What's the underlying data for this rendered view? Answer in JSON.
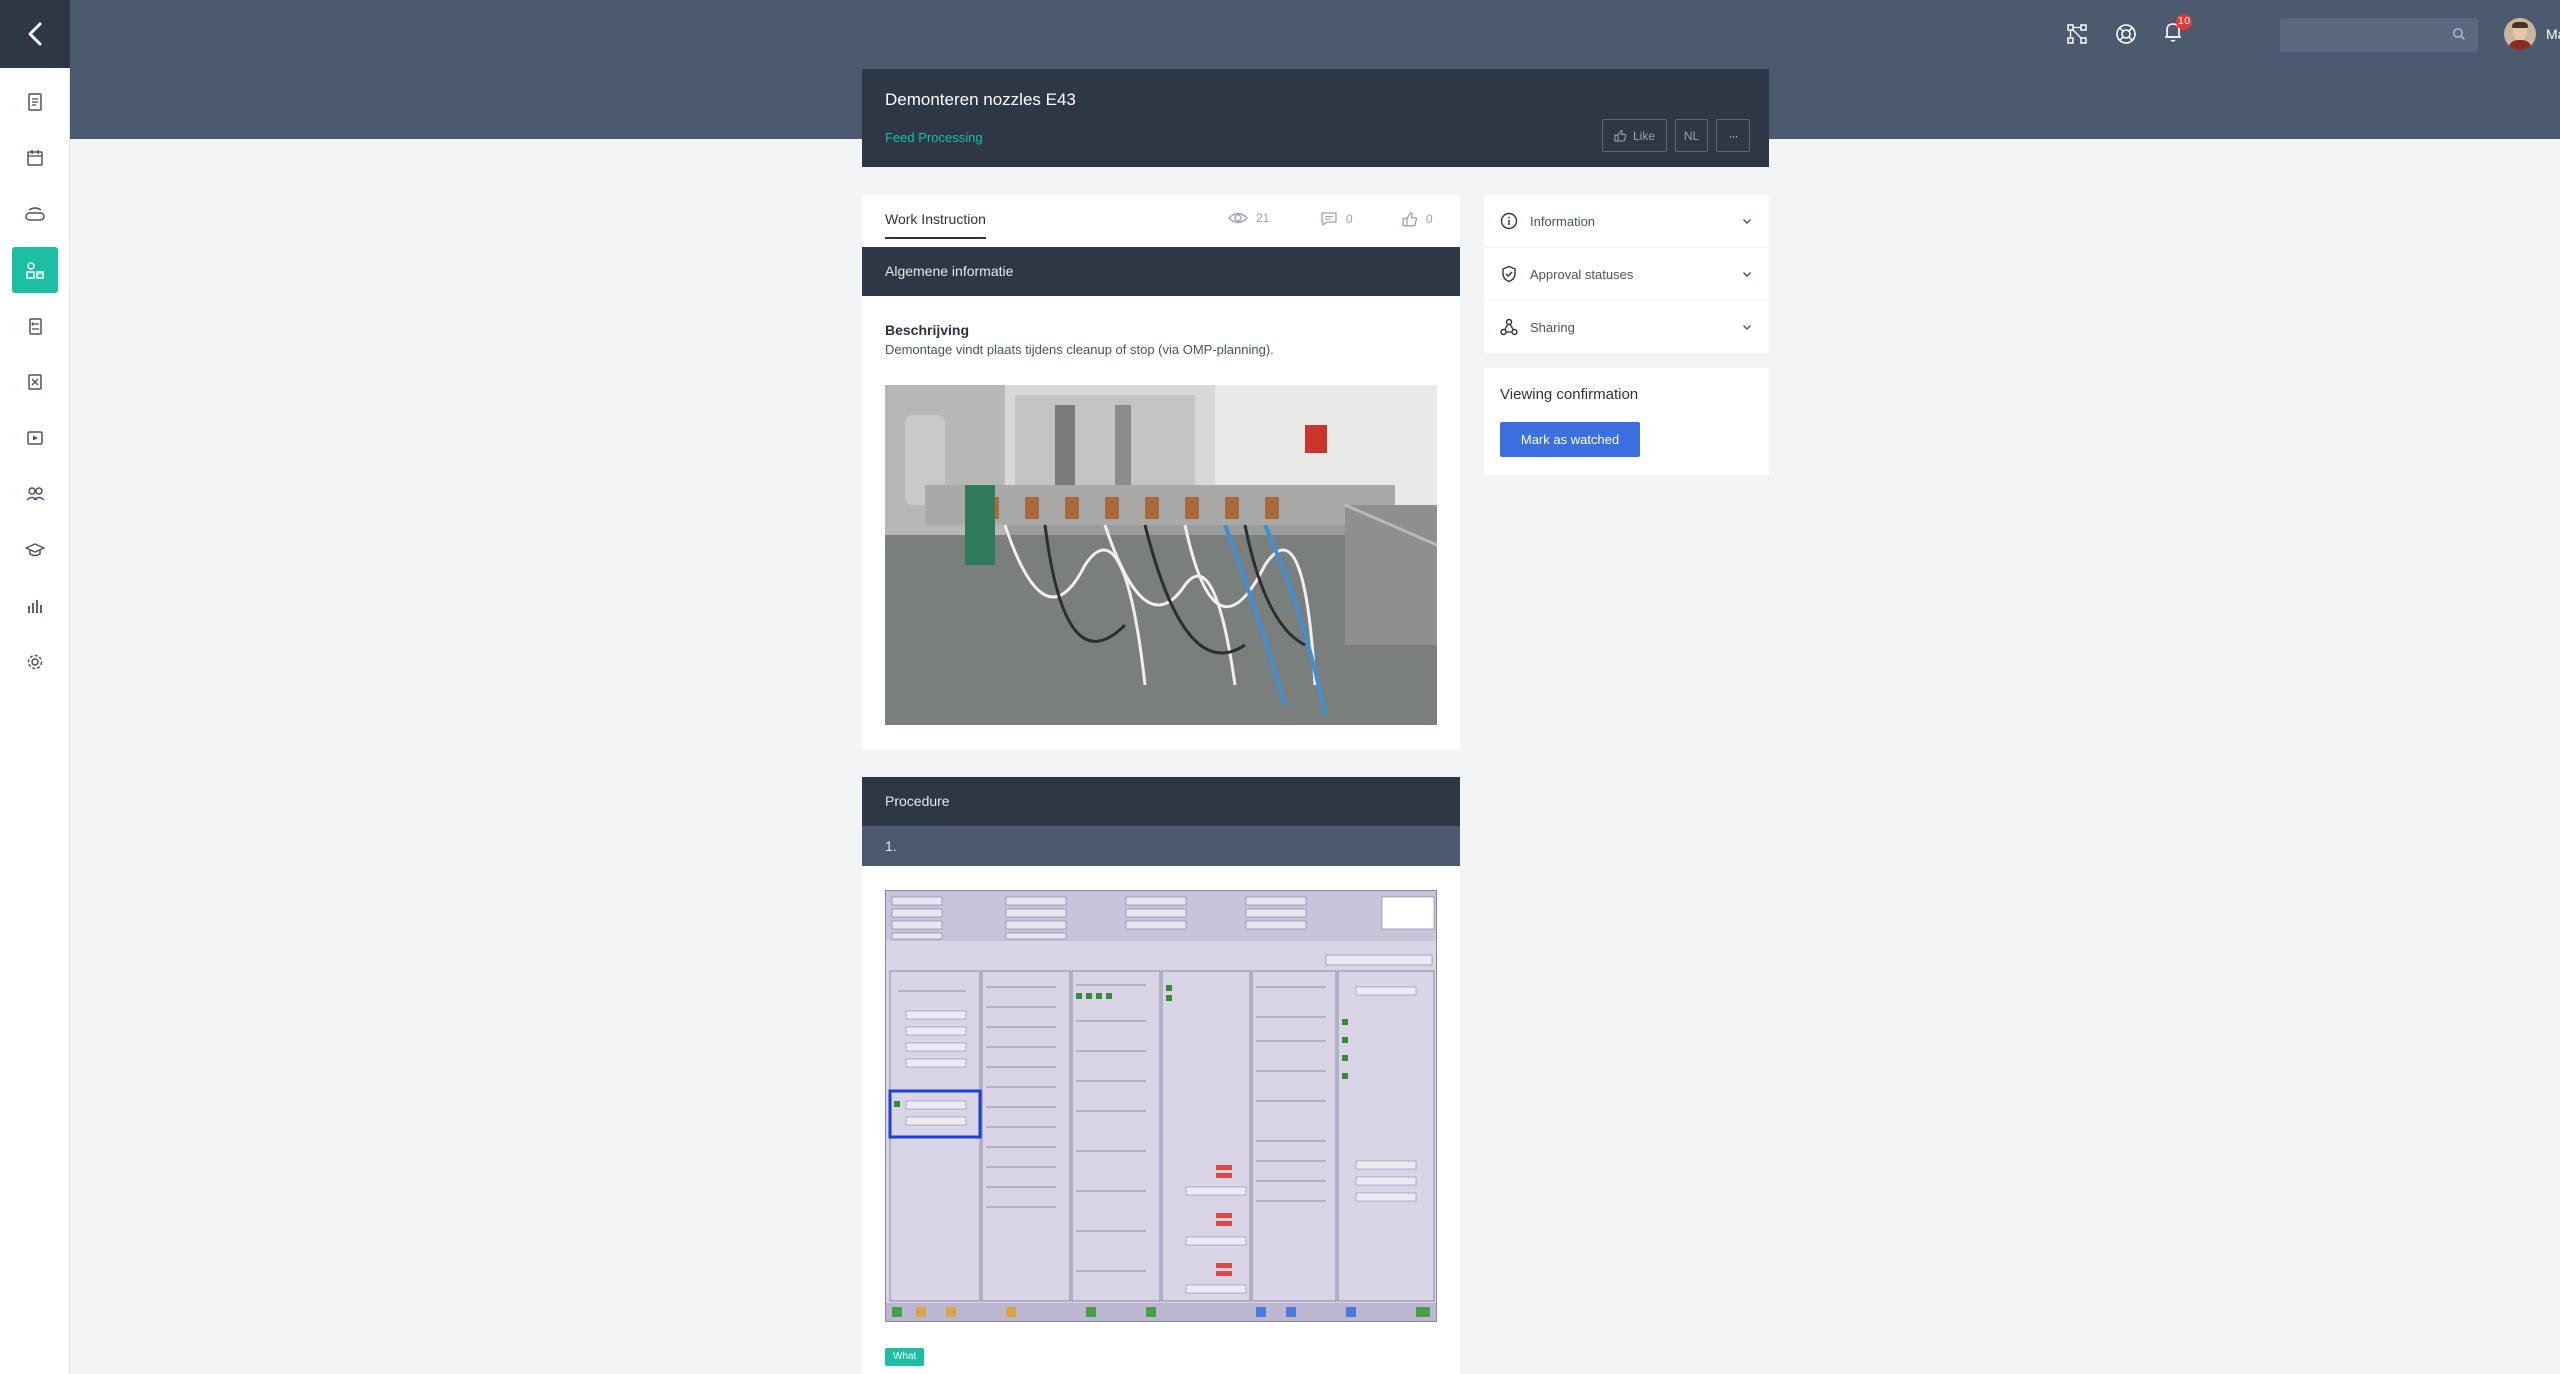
{
  "header": {
    "notifications_count": "10",
    "search_placeholder": "",
    "user_name": "Mandy"
  },
  "document": {
    "title": "Demonteren nozzles E43",
    "category": "Feed Processing",
    "like_label": "Like",
    "language_label": "NL",
    "more_label": "···"
  },
  "tabs": {
    "active_label": "Work Instruction",
    "views": "21",
    "comments": "0",
    "likes": "0"
  },
  "general": {
    "section_title": "Algemene informatie",
    "description_label": "Beschrijving",
    "description_text": "Demontage vindt plaats tijdens cleanup of stop (via OMP-planning)."
  },
  "procedure": {
    "section_title": "Procedure",
    "step_label": "1.",
    "tag": "What"
  },
  "sidebar_right": {
    "information": "Information",
    "approval": "Approval statuses",
    "sharing": "Sharing",
    "confirmation_title": "Viewing confirmation",
    "mark_button": "Mark as watched"
  },
  "nav": {
    "icons": [
      "back-icon",
      "document-icon",
      "calendar-icon",
      "conveyor-icon",
      "grid-icon",
      "clipboard-icon",
      "task-icon",
      "video-icon",
      "group-icon",
      "graduation-icon",
      "bar-chart-icon",
      "gear-icon"
    ],
    "active_index": 3
  },
  "colors": {
    "sidebar_active": "#1cbfa2",
    "header_bg": "#4c5a70",
    "dark_panel": "#2d3746",
    "primary_button": "#3b6fe0",
    "category_text": "#1cbfa2"
  }
}
